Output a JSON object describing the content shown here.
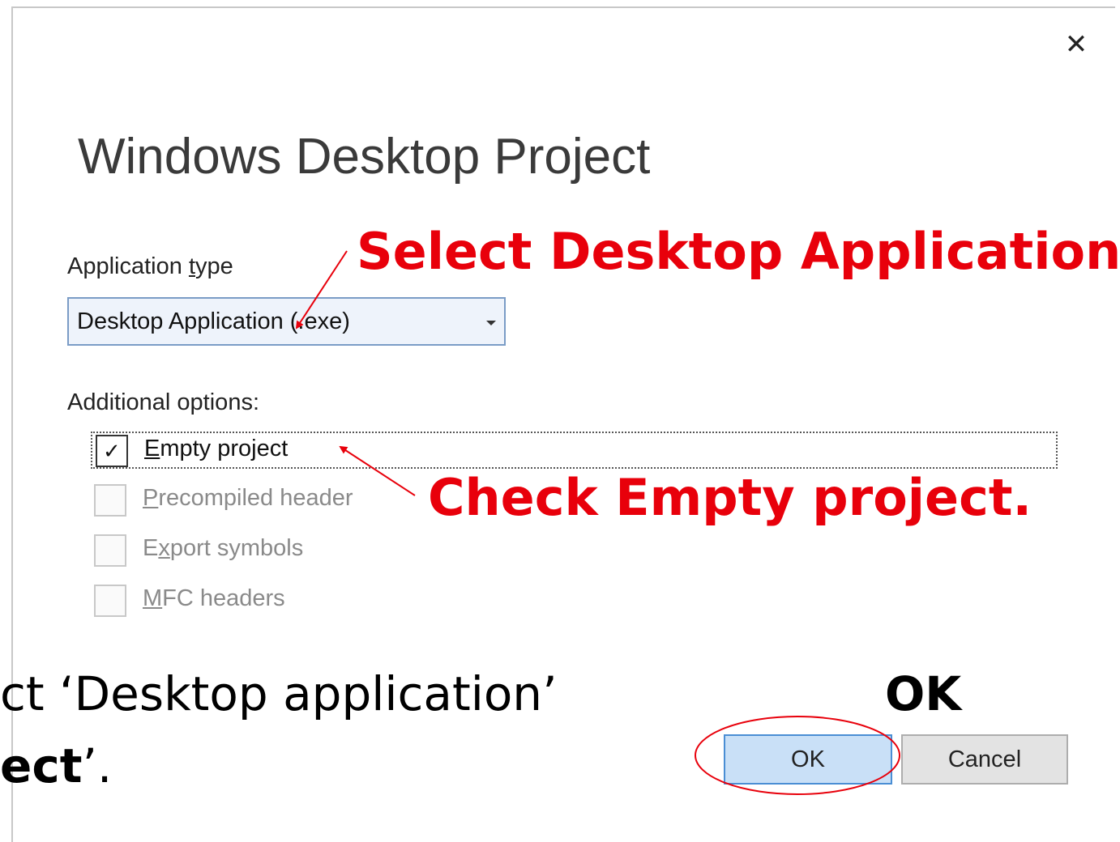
{
  "dialog": {
    "close_glyph": "✕",
    "title": "Windows Desktop Project",
    "application_type": {
      "label_pre": "Application ",
      "label_mnemonic": "t",
      "label_post": "ype",
      "selected_value": "Desktop Application (.exe)"
    },
    "additional_options": {
      "label": "Additional options:",
      "items": [
        {
          "mnemonic": "E",
          "rest": "mpty project",
          "checked": true,
          "enabled": true
        },
        {
          "mnemonic": "P",
          "rest": "recompiled header",
          "checked": false,
          "enabled": false
        },
        {
          "pre": "E",
          "mnemonic": "x",
          "rest": "port symbols",
          "checked": false,
          "enabled": false
        },
        {
          "mnemonic": "M",
          "rest": "FC headers",
          "checked": false,
          "enabled": false
        }
      ]
    },
    "buttons": {
      "ok": "OK",
      "cancel": "Cancel"
    }
  },
  "annotations": {
    "select_app": "Select Desktop Application.",
    "check_empty": "Check Empty project.",
    "ok": "OK",
    "color": "#e8000b"
  },
  "caption": {
    "line1": "ct ‘Desktop application’",
    "line2_bold": "ect",
    "line2_rest": "’."
  }
}
